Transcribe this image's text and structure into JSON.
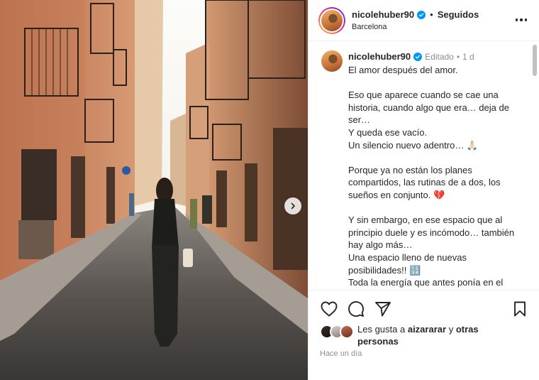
{
  "post": {
    "location": "Barcelona",
    "header": {
      "username": "nicolehuber90",
      "separator": "•",
      "follow_status": "Seguidos"
    },
    "caption": {
      "username": "nicolehuber90",
      "edited_label": "Editado",
      "dot": "•",
      "time": "1 d",
      "paragraphs": [
        "El amor después del amor.",
        "Eso que aparece cuando se cae una historia, cuando algo que era… deja de ser…\nY queda ese vacío.\nUn silencio nuevo adentro… 🙏🏻",
        "Porque ya no están los planes compartidos, las rutinas de a dos, los sueños en conjunto. 💔",
        "Y sin embargo, en ese espacio que al principio duele y es incómodo… también hay algo más…\nUna espacio lleno de nuevas posibilidades!! 🔢\nToda la energía que antes ponía en el"
      ]
    },
    "likes": {
      "prefix": "Les gusta a",
      "user": "aizararar",
      "conjunction": "y",
      "others": "otras personas"
    },
    "time_ago": "Hace un día"
  },
  "icons": {
    "verified": "verified-badge-icon",
    "more": "more-options-icon",
    "like": "heart-icon",
    "comment": "comment-icon",
    "share": "paper-plane-icon",
    "save": "bookmark-icon",
    "next": "chevron-right-icon"
  },
  "colors": {
    "verified": "#0095f6",
    "muted": "#8e8e8e",
    "text": "#262626"
  }
}
